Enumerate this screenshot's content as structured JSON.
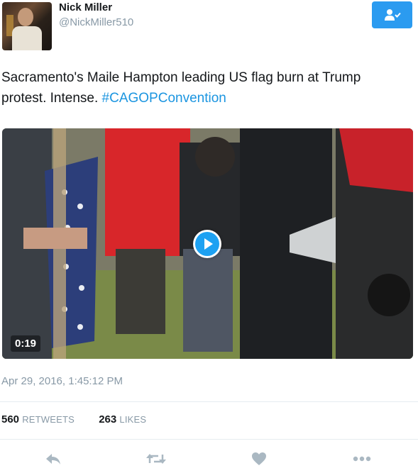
{
  "user": {
    "display_name": "Nick Miller",
    "handle": "@NickMiller510",
    "avatar_icon": "user-avatar"
  },
  "follow_button": {
    "icon": "follow-user-icon",
    "color": "#2b9bf0"
  },
  "tweet": {
    "text": "Sacramento's Maile Hampton leading US flag burn at Trump protest. Intense. ",
    "hashtag": "#CAGOPConvention",
    "hashtag_color": "#1b95e0"
  },
  "media": {
    "duration": "0:19",
    "play_icon": "play-icon"
  },
  "timestamp": "Apr 29, 2016, 1:45:12 PM",
  "stats": {
    "retweets_count": "560",
    "retweets_label": "RETWEETS",
    "likes_count": "263",
    "likes_label": "LIKES"
  },
  "actions": {
    "reply_icon": "reply-icon",
    "retweet_icon": "retweet-icon",
    "like_icon": "heart-icon",
    "more_icon": "more-icon"
  }
}
